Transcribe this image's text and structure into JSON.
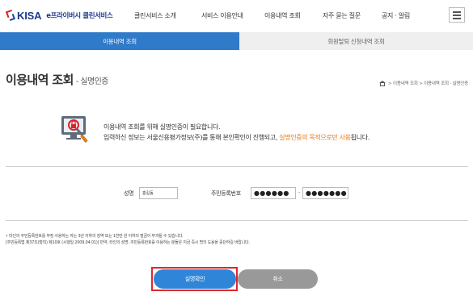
{
  "header": {
    "logo_text": "KISA",
    "logo_sub": "e프라이버시 클린서비스",
    "nav": [
      "클린서비스 소개",
      "서비스 이용안내",
      "이용내역 조회",
      "자주 묻는 질문",
      "공지 · 알림"
    ],
    "menu_icon": "hamburger-icon"
  },
  "tabs": [
    {
      "label": "이용내역 조회",
      "active": true
    },
    {
      "label": "회원탈퇴 신청내역 조회",
      "active": false
    }
  ],
  "page": {
    "title": "이용내역 조회",
    "subtitle": "- 실명인증",
    "breadcrumb": "> 이용내역 조회 > 이용내역 조회 · 실명인증"
  },
  "info": {
    "line1": "이용내역 조회를 위해 실명인증이 필요합니다.",
    "line2_prefix": "입력하신 정보는 서울신용평가정보(주)를 통해 본인확인이 진행되고, ",
    "line2_highlight": "실명인증의 목적으로만 사용",
    "line2_suffix": "됩니다.",
    "icon": "lock-monitor-search-icon"
  },
  "form": {
    "name_label": "성명",
    "name_value": "홍길동",
    "rrn_label": "주민등록번호",
    "rrn_front": "●●●●●●",
    "rrn_separator": "-",
    "rrn_back": "●●●●●●●"
  },
  "notice": {
    "line1": "• 타인의 주민등록번호를 부정 사용하는 자는 3년 이하의 징역 또는 1천만 원 이하의 벌금이 부과될 수 있습니다.",
    "line2": "[주민등록법 제37조(벌칙) 제10호 (시행일 2009.04.01)] 만약, 타인의 성명, 주민등록번호를 이용하는 분들은 지금 즉시 명의 도용을 중단하길 바랍니다."
  },
  "buttons": {
    "confirm": "실명확인",
    "cancel": "취소"
  },
  "colors": {
    "accent": "#2f7ac9",
    "highlight": "#e07a1f",
    "focus_outline": "#e2262a"
  }
}
